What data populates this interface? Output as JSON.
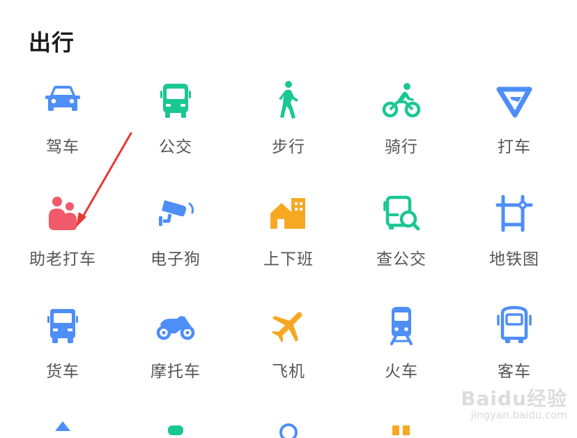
{
  "section": {
    "title": "出行"
  },
  "colors": {
    "blue": "#4d8ef7",
    "green": "#19c792",
    "pink": "#f05a6b",
    "amber": "#f7a823",
    "label": "#555555"
  },
  "items": [
    {
      "label": "驾车",
      "icon": "car-icon"
    },
    {
      "label": "公交",
      "icon": "bus-icon"
    },
    {
      "label": "步行",
      "icon": "walking-person-icon"
    },
    {
      "label": "骑行",
      "icon": "cyclist-icon"
    },
    {
      "label": "打车",
      "icon": "taxi-logo-icon"
    },
    {
      "label": "助老打车",
      "icon": "elderly-pair-icon"
    },
    {
      "label": "电子狗",
      "icon": "traffic-camera-icon"
    },
    {
      "label": "上下班",
      "icon": "home-office-icon"
    },
    {
      "label": "查公交",
      "icon": "bus-search-icon"
    },
    {
      "label": "地铁图",
      "icon": "subway-map-icon"
    },
    {
      "label": "货车",
      "icon": "truck-icon"
    },
    {
      "label": "摩托车",
      "icon": "motorcycle-icon"
    },
    {
      "label": "飞机",
      "icon": "airplane-icon"
    },
    {
      "label": "火车",
      "icon": "train-icon"
    },
    {
      "label": "客车",
      "icon": "coach-icon"
    }
  ],
  "watermark": {
    "brand": "Baidu经验",
    "url": "jingyan.baidu.com"
  }
}
